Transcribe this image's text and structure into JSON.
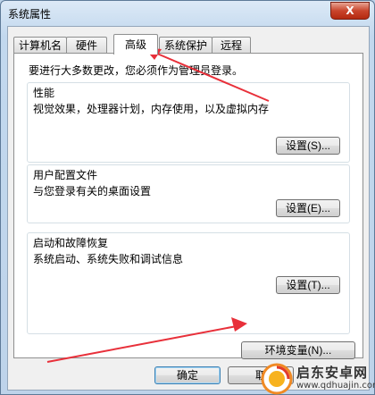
{
  "window": {
    "title": "系统属性",
    "close_label": "X"
  },
  "tabs": [
    {
      "label": "计算机名"
    },
    {
      "label": "硬件"
    },
    {
      "label": "高级",
      "active": true
    },
    {
      "label": "系统保护"
    },
    {
      "label": "远程"
    }
  ],
  "panel": {
    "intro": "要进行大多数更改，您必须作为管理员登录。",
    "performance": {
      "title": "性能",
      "desc": "视觉效果，处理器计划，内存使用，以及虚拟内存",
      "button": "设置(S)..."
    },
    "profile": {
      "title": "用户配置文件",
      "desc": "与您登录有关的桌面设置",
      "button": "设置(E)..."
    },
    "startup": {
      "title": "启动和故障恢复",
      "desc": "系统启动、系统失败和调试信息",
      "button": "设置(T)..."
    },
    "env_button": "环境变量(N)..."
  },
  "footer": {
    "ok": "确定",
    "cancel": "取"
  },
  "watermark": {
    "line1": "启东安卓网",
    "line2": "www.qdhuajin.com"
  },
  "colors": {
    "annotation_arrow": "#e8303a",
    "close_button": "#c9452c"
  }
}
